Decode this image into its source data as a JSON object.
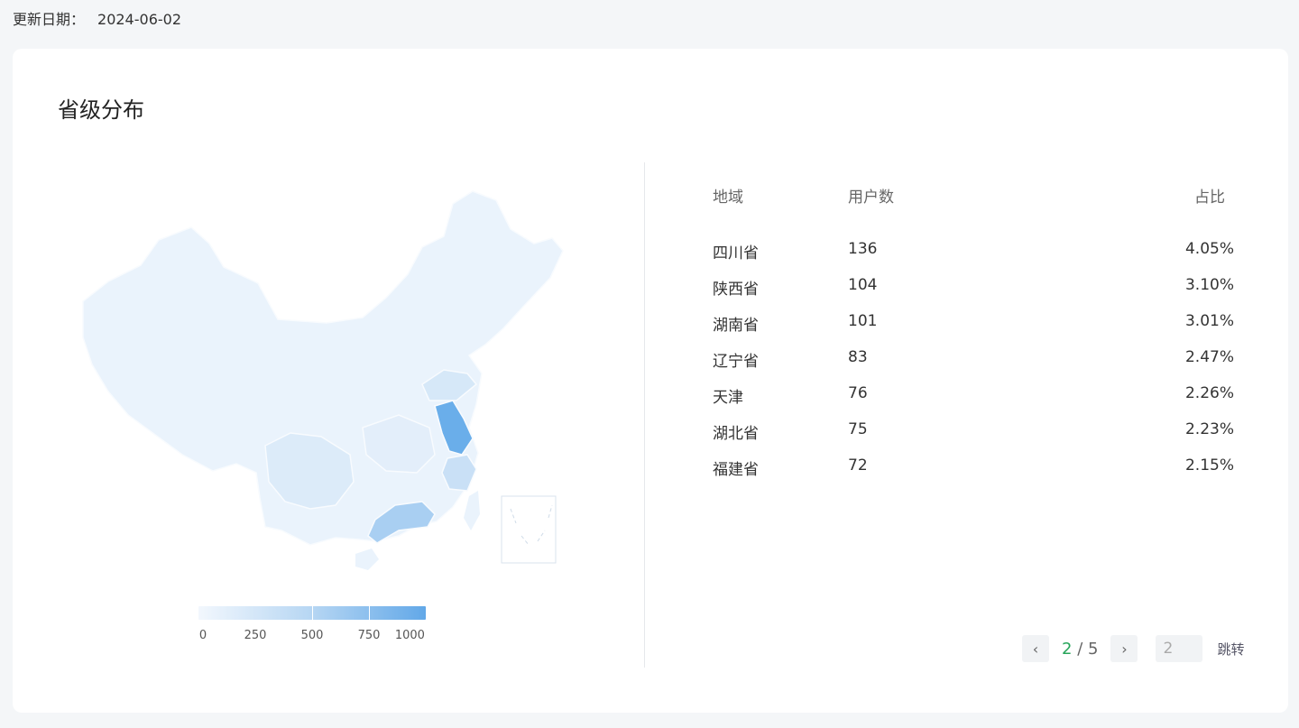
{
  "update": {
    "label": "更新日期：",
    "date": "2024-06-02"
  },
  "card": {
    "title": "省级分布"
  },
  "legend": {
    "labels": [
      "0",
      "250",
      "500",
      "750",
      "1000"
    ]
  },
  "table": {
    "headers": {
      "region": "地域",
      "users": "用户数",
      "pct": "占比"
    },
    "rows": [
      {
        "region": "四川省",
        "users": "136",
        "pct": "4.05%"
      },
      {
        "region": "陕西省",
        "users": "104",
        "pct": "3.10%"
      },
      {
        "region": "湖南省",
        "users": "101",
        "pct": "3.01%"
      },
      {
        "region": "辽宁省",
        "users": "83",
        "pct": "2.47%"
      },
      {
        "region": "天津",
        "users": "76",
        "pct": "2.26%"
      },
      {
        "region": "湖北省",
        "users": "75",
        "pct": "2.23%"
      },
      {
        "region": "福建省",
        "users": "72",
        "pct": "2.15%"
      }
    ]
  },
  "pager": {
    "current": "2",
    "separator": "/",
    "total": "5",
    "input_value": "2",
    "jump_label": "跳转",
    "prev_icon": "chevron-left-icon",
    "next_icon": "chevron-right-icon"
  },
  "colors": {
    "accent": "#27a55a",
    "map_low": "#f2f7fd",
    "map_high": "#62a8e8"
  }
}
